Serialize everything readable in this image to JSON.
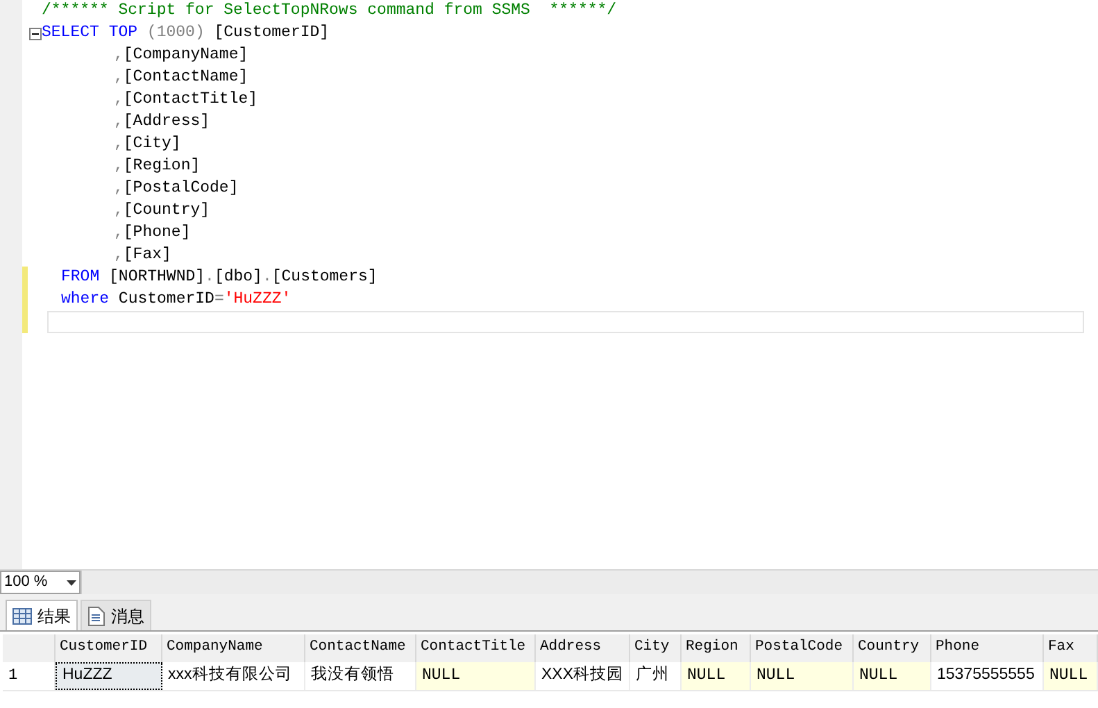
{
  "editor": {
    "lines": [
      {
        "kind": "comment",
        "changed": false,
        "segments": [
          {
            "kind": "comment",
            "text": "/****** Script for SelectTopNRows command from SSMS  ******/"
          }
        ]
      },
      {
        "kind": "first",
        "changed": false,
        "segments": [
          {
            "kind": "keyword",
            "text": "SELECT"
          },
          {
            "kind": "keyword",
            "text": " TOP"
          },
          {
            "kind": "punct",
            "text": " (1000) "
          },
          {
            "kind": "plain",
            "text": "[CustomerID]"
          }
        ]
      },
      {
        "kind": "column",
        "changed": false,
        "segments": [
          {
            "kind": "punct",
            "text": ","
          },
          {
            "kind": "plain",
            "text": "[CompanyName]"
          }
        ]
      },
      {
        "kind": "column",
        "changed": false,
        "segments": [
          {
            "kind": "punct",
            "text": ","
          },
          {
            "kind": "plain",
            "text": "[ContactName]"
          }
        ]
      },
      {
        "kind": "column",
        "changed": false,
        "segments": [
          {
            "kind": "punct",
            "text": ","
          },
          {
            "kind": "plain",
            "text": "[ContactTitle]"
          }
        ]
      },
      {
        "kind": "column",
        "changed": false,
        "segments": [
          {
            "kind": "punct",
            "text": ","
          },
          {
            "kind": "plain",
            "text": "[Address]"
          }
        ]
      },
      {
        "kind": "column",
        "changed": false,
        "segments": [
          {
            "kind": "punct",
            "text": ","
          },
          {
            "kind": "plain",
            "text": "[City]"
          }
        ]
      },
      {
        "kind": "column",
        "changed": false,
        "segments": [
          {
            "kind": "punct",
            "text": ","
          },
          {
            "kind": "plain",
            "text": "[Region]"
          }
        ]
      },
      {
        "kind": "column",
        "changed": false,
        "segments": [
          {
            "kind": "punct",
            "text": ","
          },
          {
            "kind": "plain",
            "text": "[PostalCode]"
          }
        ]
      },
      {
        "kind": "column",
        "changed": false,
        "segments": [
          {
            "kind": "punct",
            "text": ","
          },
          {
            "kind": "plain",
            "text": "[Country]"
          }
        ]
      },
      {
        "kind": "column",
        "changed": false,
        "segments": [
          {
            "kind": "punct",
            "text": ","
          },
          {
            "kind": "plain",
            "text": "[Phone]"
          }
        ]
      },
      {
        "kind": "column",
        "changed": false,
        "segments": [
          {
            "kind": "punct",
            "text": ","
          },
          {
            "kind": "plain",
            "text": "[Fax]"
          }
        ]
      },
      {
        "kind": "clause",
        "changed": true,
        "segments": [
          {
            "kind": "keyword",
            "text": "FROM"
          },
          {
            "kind": "plain",
            "text": " [NORTHWND]"
          },
          {
            "kind": "punct",
            "text": "."
          },
          {
            "kind": "plain",
            "text": "[dbo]"
          },
          {
            "kind": "punct",
            "text": "."
          },
          {
            "kind": "plain",
            "text": "[Customers]"
          }
        ]
      },
      {
        "kind": "clause",
        "changed": true,
        "segments": [
          {
            "kind": "keyword",
            "text": "where"
          },
          {
            "kind": "plain",
            "text": " CustomerID"
          },
          {
            "kind": "punct",
            "text": "="
          },
          {
            "kind": "string",
            "text": "'HuZZZ'"
          }
        ]
      },
      {
        "kind": "blank",
        "changed": true
      }
    ]
  },
  "zoom": {
    "value": "100 %"
  },
  "result_tabs": [
    {
      "label": "结果",
      "kind": "grid",
      "selected": true
    },
    {
      "label": "消息",
      "kind": "messages",
      "selected": false
    }
  ],
  "grid": {
    "columns": [
      "CustomerID",
      "CompanyName",
      "ContactName",
      "ContactTitle",
      "Address",
      "City",
      "Region",
      "PostalCode",
      "Country",
      "Phone",
      "Fax"
    ],
    "rows": [
      {
        "number": "1",
        "cells": [
          {
            "text": "HuZZZ",
            "null": false,
            "selected": true
          },
          {
            "text": "xxx科技有限公司",
            "null": false,
            "selected": false
          },
          {
            "text": "我没有领悟",
            "null": false,
            "selected": false
          },
          {
            "text": "NULL",
            "null": true,
            "selected": false
          },
          {
            "text": "XXX科技园",
            "null": false,
            "selected": false
          },
          {
            "text": "广州",
            "null": false,
            "selected": false
          },
          {
            "text": "NULL",
            "null": true,
            "selected": false
          },
          {
            "text": "NULL",
            "null": true,
            "selected": false
          },
          {
            "text": "NULL",
            "null": true,
            "selected": false
          },
          {
            "text": "15375555555",
            "null": false,
            "selected": false
          },
          {
            "text": "NULL",
            "null": true,
            "selected": false
          }
        ]
      }
    ]
  }
}
